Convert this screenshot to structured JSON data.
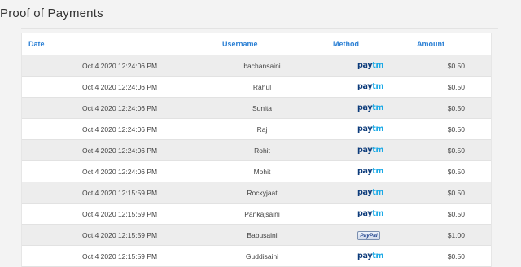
{
  "page": {
    "title": "Proof of Payments"
  },
  "table": {
    "headers": {
      "date": "Date",
      "username": "Username",
      "method": "Method",
      "amount": "Amount"
    },
    "rows": [
      {
        "date": "Oct 4 2020 12:24:06 PM",
        "username": "bachansaini",
        "method": "paytm",
        "amount": "$0.50"
      },
      {
        "date": "Oct 4 2020 12:24:06 PM",
        "username": "Rahul",
        "method": "paytm",
        "amount": "$0.50"
      },
      {
        "date": "Oct 4 2020 12:24:06 PM",
        "username": "Sunita",
        "method": "paytm",
        "amount": "$0.50"
      },
      {
        "date": "Oct 4 2020 12:24:06 PM",
        "username": "Raj",
        "method": "paytm",
        "amount": "$0.50"
      },
      {
        "date": "Oct 4 2020 12:24:06 PM",
        "username": "Rohit",
        "method": "paytm",
        "amount": "$0.50"
      },
      {
        "date": "Oct 4 2020 12:24:06 PM",
        "username": "Mohit",
        "method": "paytm",
        "amount": "$0.50"
      },
      {
        "date": "Oct 4 2020 12:15:59 PM",
        "username": "Rockyjaat",
        "method": "paytm",
        "amount": "$0.50"
      },
      {
        "date": "Oct 4 2020 12:15:59 PM",
        "username": "Pankajsaini",
        "method": "paytm",
        "amount": "$0.50"
      },
      {
        "date": "Oct 4 2020 12:15:59 PM",
        "username": "Babusaini",
        "method": "paypal",
        "amount": "$1.00"
      },
      {
        "date": "Oct 4 2020 12:15:59 PM",
        "username": "Guddisaini",
        "method": "paytm",
        "amount": "$0.50"
      }
    ]
  },
  "logos": {
    "paytm": {
      "pay": "pay",
      "tm": "tm"
    },
    "paypal": "PayPal"
  },
  "colors": {
    "header_text": "#2a7fd4",
    "row_alt": "#ededed",
    "paytm_dark": "#0b3a7a",
    "paytm_light": "#1aa9e6"
  }
}
